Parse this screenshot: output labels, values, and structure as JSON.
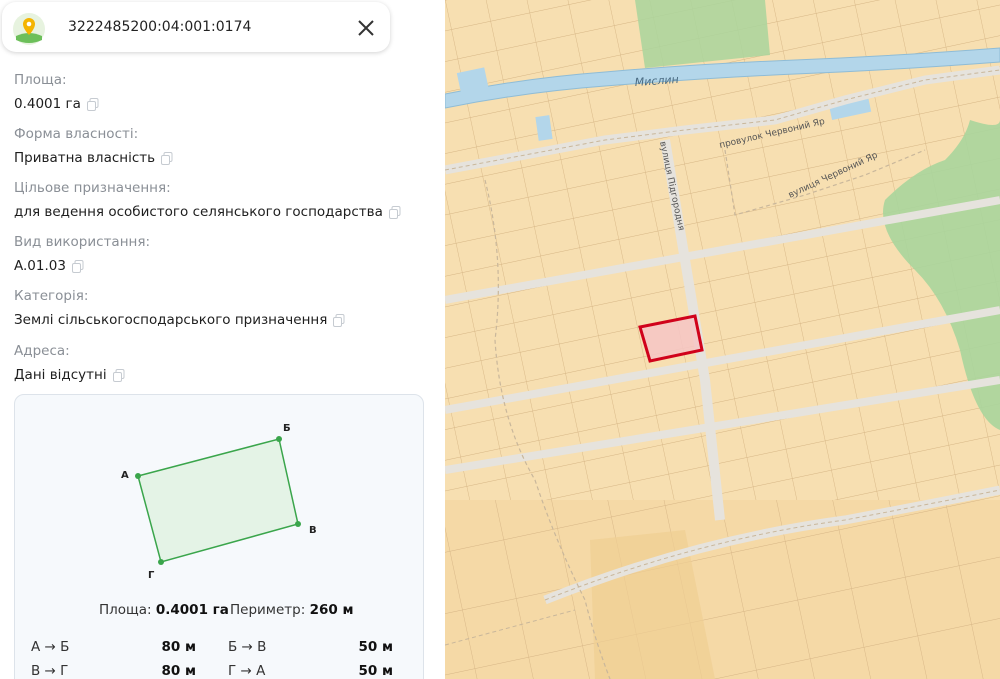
{
  "search": {
    "query": "3222485200:04:001:0174"
  },
  "fields": [
    {
      "label": "Площа:",
      "value": "0.4001 га"
    },
    {
      "label": "Форма власності:",
      "value": "Приватна власність"
    },
    {
      "label": "Цільове призначення:",
      "value": "для ведення особистого селянського господарства"
    },
    {
      "label": "Вид використання:",
      "value": "A.01.03"
    },
    {
      "label": "Категорія:",
      "value": "Землі сільськогосподарського призначення"
    },
    {
      "label": "Адреса:",
      "value": "Дані відсутні"
    }
  ],
  "shape": {
    "points": [
      "А",
      "Б",
      "В",
      "Г"
    ],
    "area_label": "Площа:",
    "area_value": "0.4001 га",
    "perimeter_label": "Периметр:",
    "perimeter_value": "260 м",
    "sides": [
      {
        "name": "А → Б",
        "length": "80 м"
      },
      {
        "name": "Б → В",
        "length": "50 м"
      },
      {
        "name": "В → Г",
        "length": "80 м"
      },
      {
        "name": "Г → А",
        "length": "50 м"
      }
    ]
  },
  "map": {
    "labels": {
      "river": "Мислин",
      "street1": "провулок Червоний Яр",
      "street2": "вулиця Червоний Яр",
      "street3": "вулиця Підгородня"
    },
    "colors": {
      "parcel": "#f7dfb1",
      "parcel_border": "#d9b98a",
      "highlight": "#d0021b",
      "water": "#b3d6ea",
      "forest": "#a9d59c"
    }
  }
}
